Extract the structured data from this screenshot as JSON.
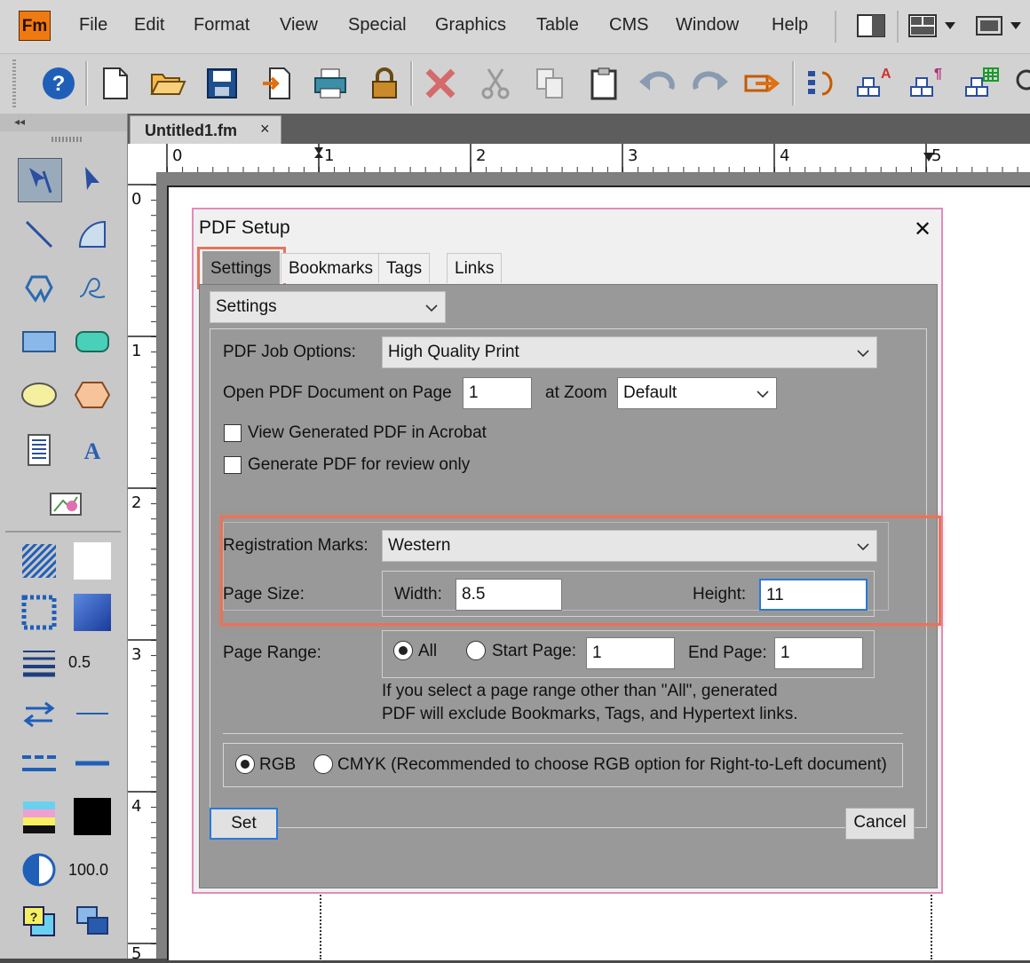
{
  "app": {
    "logo": "Fm"
  },
  "menu": [
    "File",
    "Edit",
    "Format",
    "View",
    "Special",
    "Graphics",
    "Table",
    "CMS",
    "Window",
    "Help"
  ],
  "toolbar_icons": [
    "help-icon",
    "new-document-icon",
    "open-folder-icon",
    "save-icon",
    "import-icon",
    "print-icon",
    "lock-icon",
    "delete-icon",
    "cut-icon",
    "copy-icon",
    "paste-icon",
    "undo-icon",
    "redo-icon",
    "go-icon",
    "paragraph-flow-icon",
    "char-tag-icon",
    "para-tag-icon",
    "table-tag-icon"
  ],
  "document_tab": {
    "title": "Untitled1.fm",
    "close": "×"
  },
  "ruler": {
    "h": [
      "0",
      "1",
      "2",
      "3",
      "4",
      "5"
    ],
    "v": [
      "0",
      "1",
      "2",
      "3",
      "4",
      "5"
    ]
  },
  "tools": {
    "line_width": "0.5",
    "tint": "100.0"
  },
  "dialog": {
    "title": "PDF Setup",
    "close": "✕",
    "tabs": [
      "Settings",
      "Bookmarks",
      "Tags",
      "Links"
    ],
    "section_select": "Settings",
    "job_options_label": "PDF Job Options:",
    "job_options_value": "High Quality Print",
    "open_on_page_label": "Open PDF Document on Page",
    "open_on_page_value": "1",
    "at_zoom_label": "at Zoom",
    "zoom_value": "Default",
    "view_in_acrobat": {
      "label": "View Generated PDF in Acrobat",
      "checked": false
    },
    "review_only": {
      "label": "Generate PDF for review only",
      "checked": false
    },
    "reg_marks_label": "Registration Marks:",
    "reg_marks_value": "Western",
    "page_size_label": "Page Size:",
    "width_label": "Width:",
    "width_value": "8.5",
    "height_label": "Height:",
    "height_value": "11",
    "page_range_label": "Page Range:",
    "range_all": "All",
    "range_start_label": "Start Page:",
    "range_start_value": "1",
    "range_end_label": "End Page:",
    "range_end_value": "1",
    "range_note_1": "If you select a page range other than \"All\",  generated",
    "range_note_2": "PDF will exclude Bookmarks, Tags, and Hypertext links.",
    "color_rgb": "RGB",
    "color_cmyk": "CMYK (Recommended to choose RGB option for Right-to-Left document)",
    "set_button": "Set",
    "cancel_button": "Cancel"
  },
  "colors": {
    "highlight": "#e8735a",
    "dialog_border": "#e08db8",
    "logo": "#f07a12"
  }
}
